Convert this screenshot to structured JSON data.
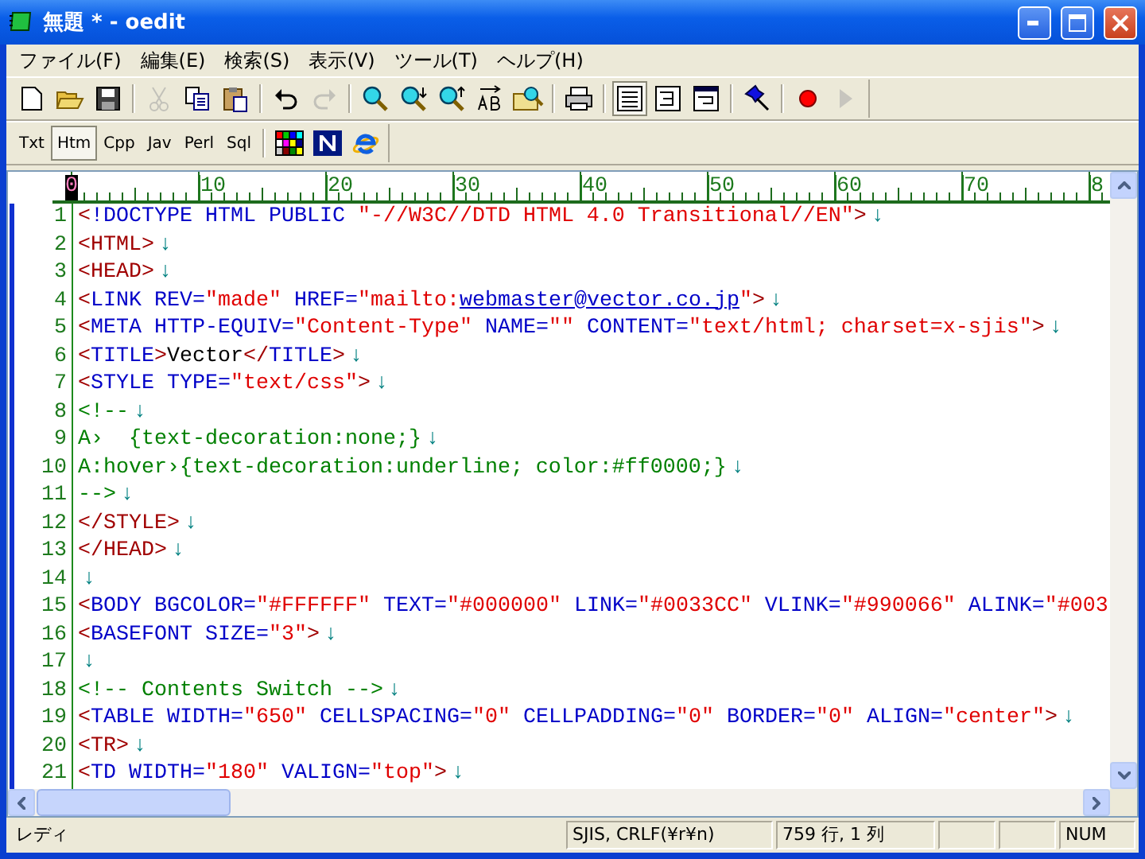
{
  "window": {
    "title": "無題 * - oedit"
  },
  "menu": [
    "ファイル(F)",
    "編集(E)",
    "検索(S)",
    "表示(V)",
    "ツール(T)",
    "ヘルプ(H)"
  ],
  "toolbar": [
    [
      {
        "kind": "new",
        "disabled": false,
        "selected": false
      },
      {
        "kind": "open",
        "disabled": false,
        "selected": false
      },
      {
        "kind": "save",
        "disabled": false,
        "selected": false
      }
    ],
    [
      {
        "kind": "cut",
        "disabled": true,
        "selected": false
      },
      {
        "kind": "copy",
        "disabled": false,
        "selected": false
      },
      {
        "kind": "paste",
        "disabled": false,
        "selected": false
      }
    ],
    [
      {
        "kind": "undo",
        "disabled": false,
        "selected": false
      },
      {
        "kind": "redo",
        "disabled": true,
        "selected": false
      }
    ],
    [
      {
        "kind": "find",
        "disabled": false,
        "selected": false
      },
      {
        "kind": "find-next",
        "disabled": false,
        "selected": false
      },
      {
        "kind": "find-prev",
        "disabled": false,
        "selected": false
      },
      {
        "kind": "replace",
        "disabled": false,
        "selected": false
      },
      {
        "kind": "grep",
        "disabled": false,
        "selected": false
      }
    ],
    [
      {
        "kind": "print",
        "disabled": false,
        "selected": false
      }
    ],
    [
      {
        "kind": "no-wrap",
        "disabled": false,
        "selected": true
      },
      {
        "kind": "wrap",
        "disabled": false,
        "selected": false
      },
      {
        "kind": "window-wrap",
        "disabled": false,
        "selected": false
      }
    ],
    [
      {
        "kind": "pin",
        "disabled": false,
        "selected": false
      }
    ],
    [
      {
        "kind": "record",
        "disabled": false,
        "selected": false
      },
      {
        "kind": "play",
        "disabled": true,
        "selected": false
      }
    ]
  ],
  "modes": [
    {
      "label": "Txt",
      "selected": false
    },
    {
      "label": "Htm",
      "selected": true
    },
    {
      "label": "Cpp",
      "selected": false
    },
    {
      "label": "Jav",
      "selected": false
    },
    {
      "label": "Perl",
      "selected": false
    },
    {
      "label": "Sql",
      "selected": false
    }
  ],
  "mode_tools": [
    {
      "kind": "palette"
    },
    {
      "kind": "n-logo"
    },
    {
      "kind": "browser"
    }
  ],
  "ruler": {
    "cursor": "0",
    "labels": [
      "10",
      "20",
      "30",
      "40",
      "50",
      "60",
      "70",
      "8"
    ]
  },
  "lines": [
    {
      "number": "1",
      "segments": [
        {
          "kind": "b",
          "text": "<"
        },
        {
          "kind": "t",
          "text": "!DOCTYPE HTML PUBLIC "
        },
        {
          "kind": "s",
          "text": "\"-//W3C//DTD HTML 4.0 Transitional//EN\""
        },
        {
          "kind": "b",
          "text": ">"
        },
        {
          "kind": "e",
          "text": "↓"
        }
      ]
    },
    {
      "number": "2",
      "segments": [
        {
          "kind": "b",
          "text": "<HTML>"
        },
        {
          "kind": "e",
          "text": "↓"
        }
      ]
    },
    {
      "number": "3",
      "segments": [
        {
          "kind": "b",
          "text": "<HEAD>"
        },
        {
          "kind": "e",
          "text": "↓"
        }
      ]
    },
    {
      "number": "4",
      "segments": [
        {
          "kind": "b",
          "text": "<"
        },
        {
          "kind": "t",
          "text": "LINK REV="
        },
        {
          "kind": "s",
          "text": "\"made\""
        },
        {
          "kind": "t",
          "text": " HREF="
        },
        {
          "kind": "s",
          "text": "\"mailto:"
        },
        {
          "kind": "u",
          "text": "webmaster@vector.co.jp"
        },
        {
          "kind": "s",
          "text": "\""
        },
        {
          "kind": "b",
          "text": ">"
        },
        {
          "kind": "e",
          "text": "↓"
        }
      ]
    },
    {
      "number": "5",
      "segments": [
        {
          "kind": "b",
          "text": "<"
        },
        {
          "kind": "t",
          "text": "META HTTP-EQUIV="
        },
        {
          "kind": "s",
          "text": "\"Content-Type\""
        },
        {
          "kind": "t",
          "text": " NAME="
        },
        {
          "kind": "s",
          "text": "\"\""
        },
        {
          "kind": "t",
          "text": " CONTENT="
        },
        {
          "kind": "s",
          "text": "\"text/html; charset=x-sjis\""
        },
        {
          "kind": "b",
          "text": ">"
        },
        {
          "kind": "e",
          "text": "↓"
        }
      ]
    },
    {
      "number": "6",
      "segments": [
        {
          "kind": "b",
          "text": "<"
        },
        {
          "kind": "t",
          "text": "TITLE"
        },
        {
          "kind": "b",
          "text": ">"
        },
        {
          "kind": "x",
          "text": "Vector"
        },
        {
          "kind": "b",
          "text": "</"
        },
        {
          "kind": "t",
          "text": "TITLE"
        },
        {
          "kind": "b",
          "text": ">"
        },
        {
          "kind": "e",
          "text": "↓"
        }
      ]
    },
    {
      "number": "7",
      "segments": [
        {
          "kind": "b",
          "text": "<"
        },
        {
          "kind": "t",
          "text": "STYLE TYPE="
        },
        {
          "kind": "s",
          "text": "\"text/css\""
        },
        {
          "kind": "b",
          "text": ">"
        },
        {
          "kind": "e",
          "text": "↓"
        }
      ]
    },
    {
      "number": "8",
      "segments": [
        {
          "kind": "c",
          "text": "<!--"
        },
        {
          "kind": "e",
          "text": "↓"
        }
      ]
    },
    {
      "number": "9",
      "segments": [
        {
          "kind": "c",
          "text": "A›  {text-decoration:none;}"
        },
        {
          "kind": "e",
          "text": "↓"
        }
      ]
    },
    {
      "number": "10",
      "segments": [
        {
          "kind": "c",
          "text": "A:hover›{text-decoration:underline; color:#ff0000;}"
        },
        {
          "kind": "e",
          "text": "↓"
        }
      ]
    },
    {
      "number": "11",
      "segments": [
        {
          "kind": "c",
          "text": "-->"
        },
        {
          "kind": "e",
          "text": "↓"
        }
      ]
    },
    {
      "number": "12",
      "segments": [
        {
          "kind": "b",
          "text": "</STYLE>"
        },
        {
          "kind": "e",
          "text": "↓"
        }
      ]
    },
    {
      "number": "13",
      "segments": [
        {
          "kind": "b",
          "text": "</HEAD>"
        },
        {
          "kind": "e",
          "text": "↓"
        }
      ]
    },
    {
      "number": "14",
      "segments": [
        {
          "kind": "e",
          "text": "↓"
        }
      ]
    },
    {
      "number": "15",
      "segments": [
        {
          "kind": "b",
          "text": "<"
        },
        {
          "kind": "t",
          "text": "BODY BGCOLOR="
        },
        {
          "kind": "s",
          "text": "\"#FFFFFF\""
        },
        {
          "kind": "t",
          "text": " TEXT="
        },
        {
          "kind": "s",
          "text": "\"#000000\""
        },
        {
          "kind": "t",
          "text": " LINK="
        },
        {
          "kind": "s",
          "text": "\"#0033CC\""
        },
        {
          "kind": "t",
          "text": " VLINK="
        },
        {
          "kind": "s",
          "text": "\"#990066\""
        },
        {
          "kind": "t",
          "text": " ALINK="
        },
        {
          "kind": "s",
          "text": "\"#003"
        }
      ]
    },
    {
      "number": "16",
      "segments": [
        {
          "kind": "b",
          "text": "<"
        },
        {
          "kind": "t",
          "text": "BASEFONT SIZE="
        },
        {
          "kind": "s",
          "text": "\"3\""
        },
        {
          "kind": "b",
          "text": ">"
        },
        {
          "kind": "e",
          "text": "↓"
        }
      ]
    },
    {
      "number": "17",
      "segments": [
        {
          "kind": "e",
          "text": "↓"
        }
      ]
    },
    {
      "number": "18",
      "segments": [
        {
          "kind": "c",
          "text": "<!-- Contents Switch -->"
        },
        {
          "kind": "e",
          "text": "↓"
        }
      ]
    },
    {
      "number": "19",
      "segments": [
        {
          "kind": "b",
          "text": "<"
        },
        {
          "kind": "t",
          "text": "TABLE WIDTH="
        },
        {
          "kind": "s",
          "text": "\"650\""
        },
        {
          "kind": "t",
          "text": " CELLSPACING="
        },
        {
          "kind": "s",
          "text": "\"0\""
        },
        {
          "kind": "t",
          "text": " CELLPADDING="
        },
        {
          "kind": "s",
          "text": "\"0\""
        },
        {
          "kind": "t",
          "text": " BORDER="
        },
        {
          "kind": "s",
          "text": "\"0\""
        },
        {
          "kind": "t",
          "text": " ALIGN="
        },
        {
          "kind": "s",
          "text": "\"center\""
        },
        {
          "kind": "b",
          "text": ">"
        },
        {
          "kind": "e",
          "text": "↓"
        }
      ]
    },
    {
      "number": "20",
      "segments": [
        {
          "kind": "b",
          "text": "<TR>"
        },
        {
          "kind": "e",
          "text": "↓"
        }
      ]
    },
    {
      "number": "21",
      "segments": [
        {
          "kind": "b",
          "text": "<"
        },
        {
          "kind": "t",
          "text": "TD WIDTH="
        },
        {
          "kind": "s",
          "text": "\"180\""
        },
        {
          "kind": "t",
          "text": " VALIGN="
        },
        {
          "kind": "s",
          "text": "\"top\""
        },
        {
          "kind": "b",
          "text": ">"
        },
        {
          "kind": "e",
          "text": "↓"
        }
      ]
    }
  ],
  "status_bar": [
    "レディ",
    "SJIS, CRLF(¥r¥n)",
    "759 行, 1 列",
    "NUM"
  ]
}
